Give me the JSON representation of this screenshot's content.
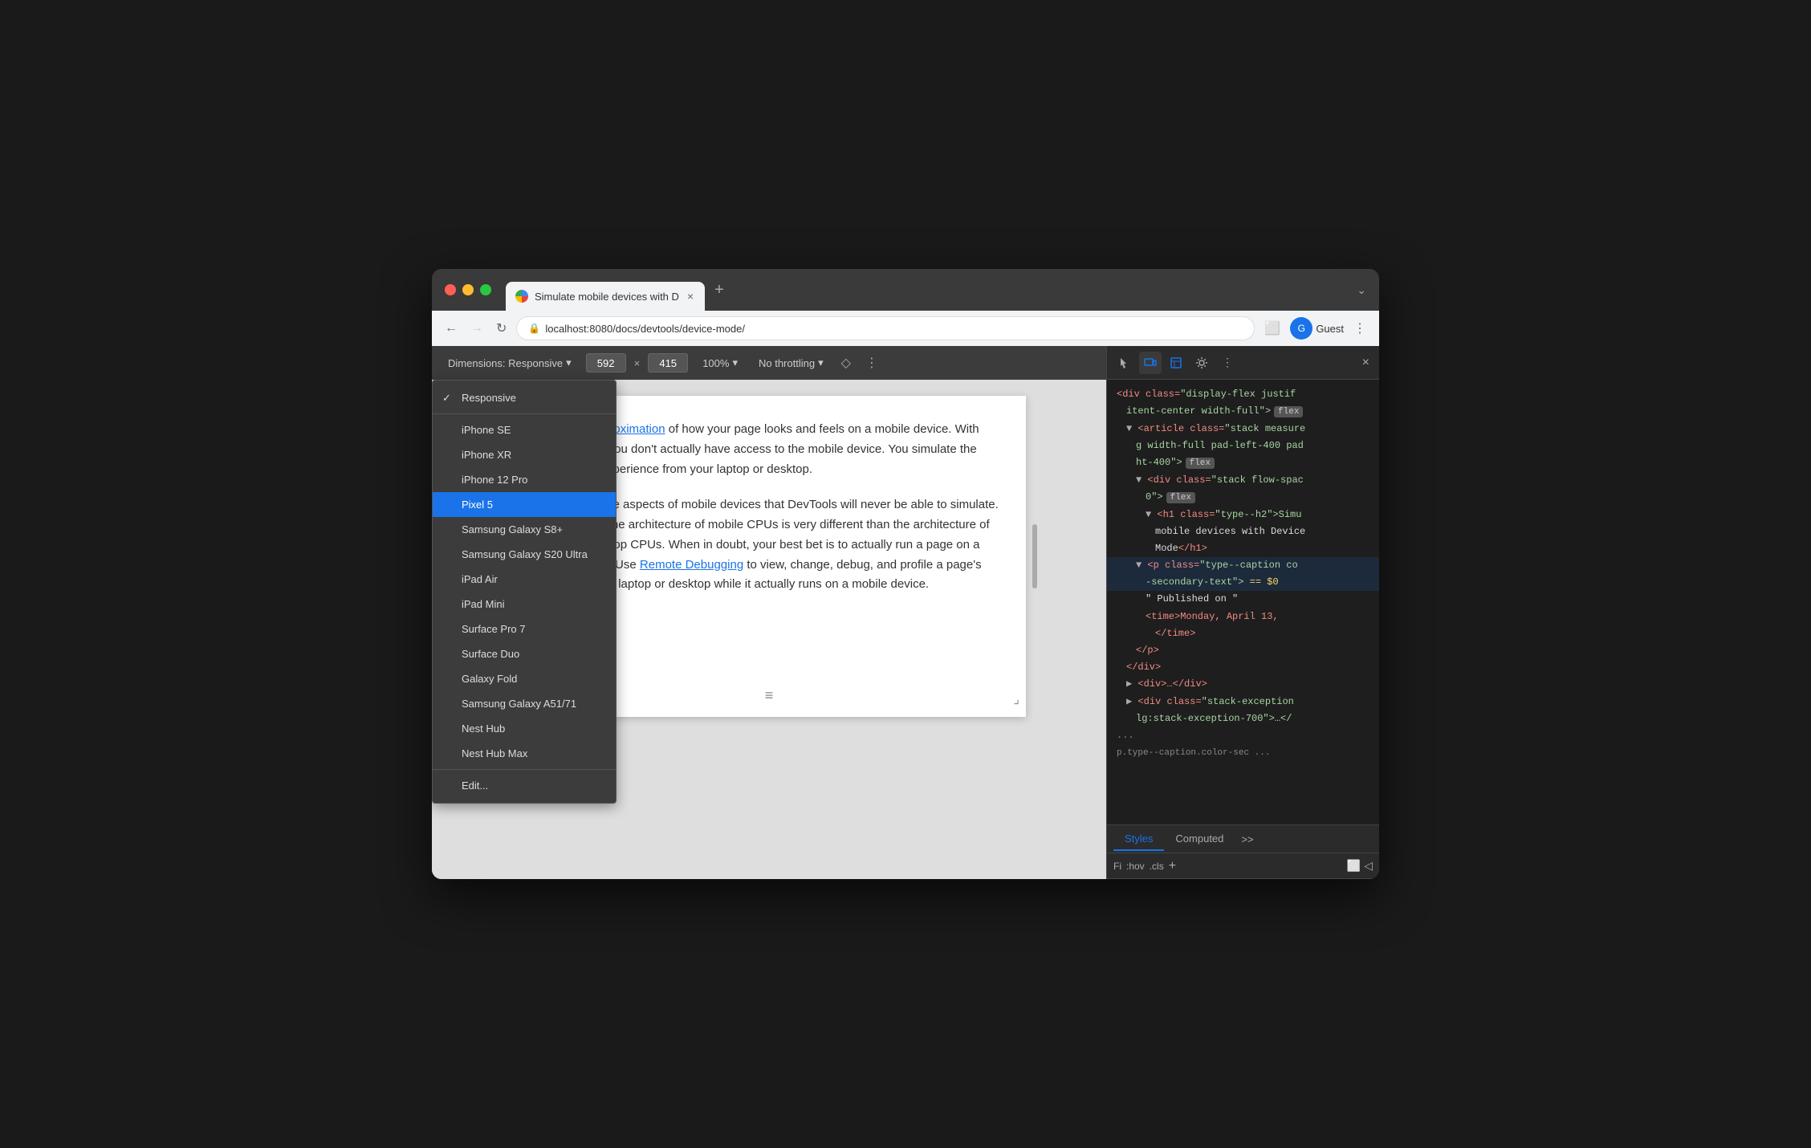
{
  "window": {
    "title": "Simulate mobile devices with DevTools"
  },
  "titlebar": {
    "tab_title": "Simulate mobile devices with D",
    "tab_close": "×",
    "new_tab": "+",
    "menu_chevron": "⌄"
  },
  "addressbar": {
    "back": "←",
    "forward": "→",
    "refresh": "↻",
    "url": "localhost:8080/docs/devtools/device-mode/",
    "lock_icon": "🔒",
    "profile_name": "Guest",
    "devtools_icon": "⬜",
    "more_icon": "⋮"
  },
  "device_toolbar": {
    "dimensions_label": "Dimensions: Responsive",
    "width": "592",
    "height": "415",
    "cross": "×",
    "zoom_label": "100%",
    "zoom_arrow": "▾",
    "throttle_label": "No throttling",
    "throttle_arrow": "▾",
    "sensor_icon": "◇",
    "more_icon": "⋮"
  },
  "device_menu": {
    "items": [
      {
        "id": "responsive",
        "label": "Responsive",
        "checked": true,
        "selected": false
      },
      {
        "id": "iphone-se",
        "label": "iPhone SE",
        "checked": false,
        "selected": false
      },
      {
        "id": "iphone-xr",
        "label": "iPhone XR",
        "checked": false,
        "selected": false
      },
      {
        "id": "iphone-12-pro",
        "label": "iPhone 12 Pro",
        "checked": false,
        "selected": false
      },
      {
        "id": "pixel-5",
        "label": "Pixel 5",
        "checked": false,
        "selected": true
      },
      {
        "id": "samsung-s8",
        "label": "Samsung Galaxy S8+",
        "checked": false,
        "selected": false
      },
      {
        "id": "samsung-s20",
        "label": "Samsung Galaxy S20 Ultra",
        "checked": false,
        "selected": false
      },
      {
        "id": "ipad-air",
        "label": "iPad Air",
        "checked": false,
        "selected": false
      },
      {
        "id": "ipad-mini",
        "label": "iPad Mini",
        "checked": false,
        "selected": false
      },
      {
        "id": "surface-pro",
        "label": "Surface Pro 7",
        "checked": false,
        "selected": false
      },
      {
        "id": "surface-duo",
        "label": "Surface Duo",
        "checked": false,
        "selected": false
      },
      {
        "id": "galaxy-fold",
        "label": "Galaxy Fold",
        "checked": false,
        "selected": false
      },
      {
        "id": "samsung-a51",
        "label": "Samsung Galaxy A51/71",
        "checked": false,
        "selected": false
      },
      {
        "id": "nest-hub",
        "label": "Nest Hub",
        "checked": false,
        "selected": false
      },
      {
        "id": "nest-hub-max",
        "label": "Nest Hub Max",
        "checked": false,
        "selected": false
      }
    ],
    "edit_label": "Edit..."
  },
  "page_content": {
    "link1": "first-order approximation",
    "text1": " of how your page looks and feels on a mobile device. With Device Mode you don't actually have access to the mobile device. You simulate the mobile user experience from your laptop or desktop.",
    "text2": "There are some aspects of mobile devices that DevTools will never be able to simulate. For example, the architecture of mobile CPUs is very different than the architecture of laptop or desktop CPUs. When in doubt, your best bet is to actually run a page on a mobile device. Use ",
    "link2": "Remote Debugging",
    "text3": " to view, change, debug, and profile a page's code from your laptop or desktop while it actually runs on a mobile device."
  },
  "devtools": {
    "toolbar": {
      "cursor_icon": "⬚",
      "device_icon": "⬜",
      "console_icon": "☰",
      "settings_icon": "⚙",
      "more_icon": "⋮",
      "close_icon": "×"
    },
    "code": [
      {
        "indent": 0,
        "content": "<div class=\"display-flex justif",
        "type": "tag"
      },
      {
        "indent": 1,
        "content": "itent-center width-full\">",
        "type": "tag",
        "badge": "flex"
      },
      {
        "indent": 1,
        "content": "<article class=\"stack measure",
        "type": "tag"
      },
      {
        "indent": 2,
        "content": "g width-full pad-left-400 pad",
        "type": "tag"
      },
      {
        "indent": 2,
        "content": "ht-400\">",
        "type": "tag",
        "badge": "flex"
      },
      {
        "indent": 2,
        "content": "<div class=\"stack flow-spac",
        "type": "tag"
      },
      {
        "indent": 3,
        "content": "0\">",
        "type": "tag",
        "badge": "flex"
      },
      {
        "indent": 3,
        "content": "<h1 class=\"type--h2\">Simu",
        "type": "tag"
      },
      {
        "indent": 4,
        "content": "mobile devices with Device",
        "type": "text"
      },
      {
        "indent": 4,
        "content": "Mode</h1>",
        "type": "tag"
      },
      {
        "indent": 2,
        "content": "<p class=\"type--caption co",
        "type": "tag"
      },
      {
        "indent": 3,
        "content": "-secondary-text\"> == $0",
        "type": "selected",
        "badge": ""
      },
      {
        "indent": 3,
        "content": "\" Published on \"",
        "type": "text"
      },
      {
        "indent": 3,
        "content": "<time>Monday, April 13,",
        "type": "tag"
      },
      {
        "indent": 4,
        "content": "</time>",
        "type": "tag"
      },
      {
        "indent": 2,
        "content": "</p>",
        "type": "tag"
      },
      {
        "indent": 1,
        "content": "</div>",
        "type": "tag"
      },
      {
        "indent": 1,
        "content": "<div>…</div>",
        "type": "tag"
      },
      {
        "indent": 1,
        "content": "<div class=\"stack-exception",
        "type": "tag"
      },
      {
        "indent": 2,
        "content": "lg:stack-exception-700\">…</",
        "type": "tag"
      },
      {
        "indent": 0,
        "content": "...",
        "type": "ellipsis"
      },
      {
        "indent": 1,
        "content": "p.type--caption.color-sec  ...",
        "type": "breadcrumb"
      }
    ],
    "tabs": {
      "styles_label": "Styles",
      "computed_label": "Computed",
      "more_label": ">>"
    },
    "filter": {
      "fi_label": "Fi",
      "hov_label": ":hov",
      "cls_label": ".cls",
      "plus_label": "+",
      "icon1": "⬜",
      "icon2": "◁"
    }
  }
}
